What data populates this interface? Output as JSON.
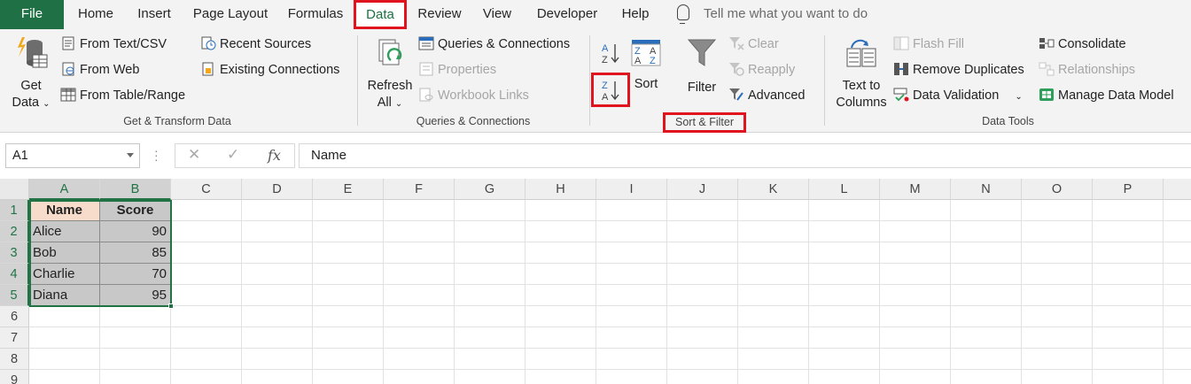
{
  "menu": {
    "tabs": [
      "File",
      "Home",
      "Insert",
      "Page Layout",
      "Formulas",
      "Data",
      "Review",
      "View",
      "Developer",
      "Help"
    ],
    "active_tab": "Data",
    "tell_me_placeholder": "Tell me what you want to do"
  },
  "ribbon": {
    "get_transform": {
      "get_data_line1": "Get",
      "get_data_line2": "Data",
      "from_text_csv": "From Text/CSV",
      "from_web": "From Web",
      "from_table_range": "From Table/Range",
      "recent_sources": "Recent Sources",
      "existing_connections": "Existing Connections",
      "label": "Get & Transform Data"
    },
    "queries": {
      "refresh_line1": "Refresh",
      "refresh_line2": "All",
      "queries_connections": "Queries & Connections",
      "properties": "Properties",
      "workbook_links": "Workbook Links",
      "label": "Queries & Connections"
    },
    "sort_filter": {
      "sort_az": "A↓Z",
      "sort_za": "Z↓A",
      "sort": "Sort",
      "filter": "Filter",
      "clear": "Clear",
      "reapply": "Reapply",
      "advanced": "Advanced",
      "label": "Sort & Filter"
    },
    "data_tools": {
      "text_to_line1": "Text to",
      "text_to_line2": "Columns",
      "flash_fill": "Flash Fill",
      "remove_duplicates": "Remove Duplicates",
      "data_validation": "Data Validation",
      "consolidate": "Consolidate",
      "relationships": "Relationships",
      "manage_data_model": "Manage Data Model",
      "label": "Data Tools"
    }
  },
  "formula_bar": {
    "name_box": "A1",
    "fx": "fx",
    "content": "Name"
  },
  "sheet": {
    "columns": [
      "A",
      "B",
      "C",
      "D",
      "E",
      "F",
      "G",
      "H",
      "I",
      "J",
      "K",
      "L",
      "M",
      "N",
      "O",
      "P"
    ],
    "rows": [
      "1",
      "2",
      "3",
      "4",
      "5",
      "6",
      "7",
      "8",
      "9"
    ],
    "headers": [
      "Name",
      "Score"
    ],
    "data": [
      [
        "Alice",
        "90"
      ],
      [
        "Bob",
        "85"
      ],
      [
        "Charlie",
        "70"
      ],
      [
        "Diana",
        "95"
      ]
    ]
  },
  "colors": {
    "excel_green": "#217346",
    "file_tab": "#1f7145",
    "highlight_red": "#e0141e",
    "header_fill_a": "#f8dccb",
    "data_fill": "#c8c8c8"
  }
}
